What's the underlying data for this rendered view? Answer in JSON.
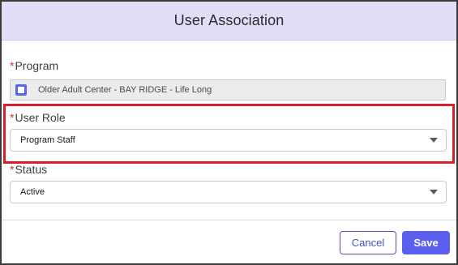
{
  "modal": {
    "title": "User Association"
  },
  "program": {
    "required_mark": "*",
    "label": "Program",
    "value": "Older Adult Center - BAY RIDGE - Life Long"
  },
  "user_role": {
    "required_mark": "*",
    "label": "User Role",
    "selected": "Program Staff"
  },
  "status": {
    "required_mark": "*",
    "label": "Status",
    "selected": "Active"
  },
  "footer": {
    "cancel_label": "Cancel",
    "save_label": "Save"
  },
  "colors": {
    "header_bg": "#e3dcf7",
    "highlight_border": "#d71f2b",
    "primary": "#5b5ff0",
    "required": "#c23934"
  },
  "icons": {
    "program_icon": "program-record-icon",
    "dropdown_icon": "chevron-down-icon"
  }
}
